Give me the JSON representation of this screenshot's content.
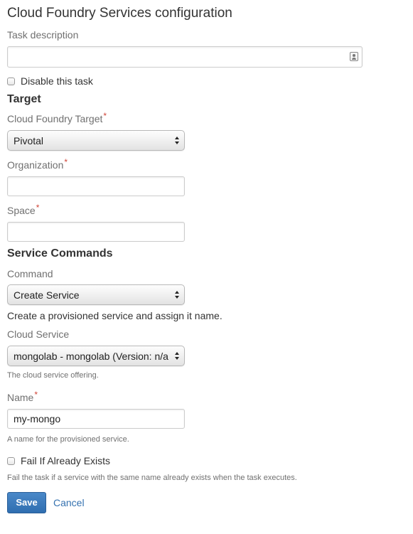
{
  "page": {
    "title": "Cloud Foundry Services configuration"
  },
  "task_description": {
    "label": "Task description",
    "value": ""
  },
  "disable_task": {
    "label": "Disable this task",
    "checked": false
  },
  "target_section": {
    "heading": "Target",
    "cf_target": {
      "label": "Cloud Foundry Target",
      "required_marker": "*",
      "selected": "Pivotal"
    },
    "organization": {
      "label": "Organization",
      "required_marker": "*",
      "value": ""
    },
    "space": {
      "label": "Space",
      "required_marker": "*",
      "value": ""
    }
  },
  "service_commands": {
    "heading": "Service Commands",
    "command": {
      "label": "Command",
      "selected": "Create Service",
      "description": "Create a provisioned service and assign it name."
    },
    "cloud_service": {
      "label": "Cloud Service",
      "selected": "mongolab - mongolab (Version: n/a)",
      "help": "The cloud service offering."
    },
    "name": {
      "label": "Name",
      "required_marker": "*",
      "value": "my-mongo",
      "help": "A name for the provisioned service."
    },
    "fail_if_exists": {
      "label": "Fail If Already Exists",
      "checked": false,
      "help": "Fail the task if a service with the same name already exists when the task executes."
    }
  },
  "actions": {
    "save_label": "Save",
    "cancel_label": "Cancel"
  },
  "colors": {
    "primary_button": "#3572b0",
    "link": "#3572b0",
    "required_marker": "#d04437",
    "label_text": "#707070"
  }
}
